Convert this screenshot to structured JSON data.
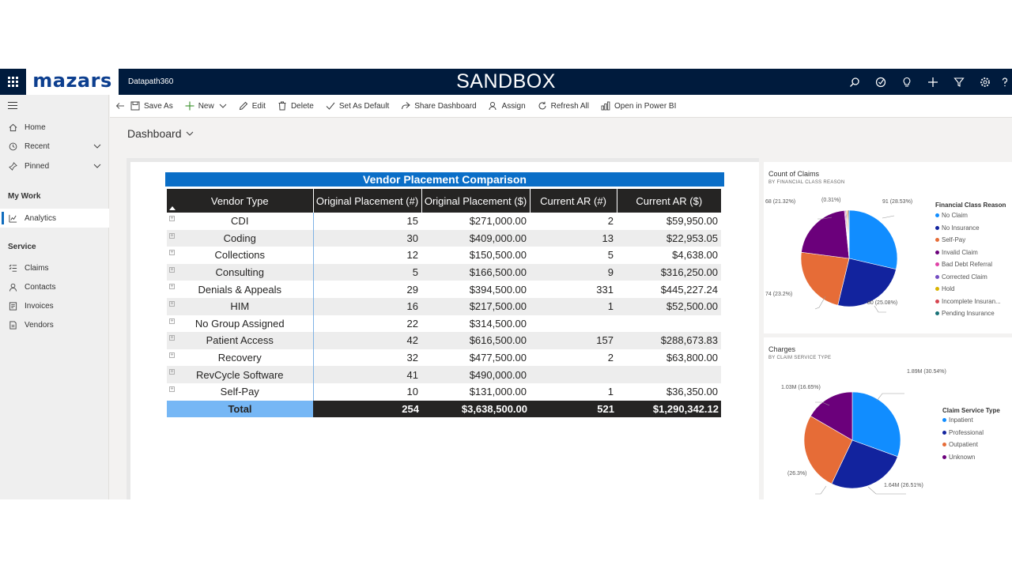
{
  "topbar": {
    "logo": "mazars",
    "app_name": "Datapath360",
    "environment": "SANDBOX",
    "icons": [
      "search-icon",
      "target-icon",
      "lightbulb-icon",
      "plus-icon",
      "filter-icon",
      "gear-icon",
      "help-icon"
    ]
  },
  "sidebar": {
    "items": [
      {
        "label": "Home",
        "icon": "home-icon"
      },
      {
        "label": "Recent",
        "icon": "clock-icon"
      },
      {
        "label": "Pinned",
        "icon": "pin-icon"
      }
    ],
    "my_work_label": "My Work",
    "analytics_label": "Analytics",
    "service_label": "Service",
    "service_items": [
      {
        "label": "Claims"
      },
      {
        "label": "Contacts"
      },
      {
        "label": "Invoices"
      },
      {
        "label": "Vendors"
      }
    ]
  },
  "commandbar": {
    "save_as": "Save As",
    "new": "New",
    "edit": "Edit",
    "delete": "Delete",
    "set_default": "Set As Default",
    "share": "Share Dashboard",
    "assign": "Assign",
    "refresh": "Refresh All",
    "open_powerbi": "Open in Power BI"
  },
  "dashboard": {
    "title": "Dashboard"
  },
  "table": {
    "title": "Vendor Placement Comparison",
    "headers": [
      "Vendor Type",
      "Original Placement (#)",
      "Original Placement ($)",
      "Current AR (#)",
      "Current AR ($)"
    ],
    "rows": [
      [
        "CDI",
        "15",
        "$271,000.00",
        "2",
        "$59,950.00"
      ],
      [
        "Coding",
        "30",
        "$409,000.00",
        "13",
        "$22,953.05"
      ],
      [
        "Collections",
        "12",
        "$150,500.00",
        "5",
        "$4,638.00"
      ],
      [
        "Consulting",
        "5",
        "$166,500.00",
        "9",
        "$316,250.00"
      ],
      [
        "Denials & Appeals",
        "29",
        "$394,500.00",
        "331",
        "$445,227.24"
      ],
      [
        "HIM",
        "16",
        "$217,500.00",
        "1",
        "$52,500.00"
      ],
      [
        "No Group Assigned",
        "22",
        "$314,500.00",
        "",
        ""
      ],
      [
        "Patient Access",
        "42",
        "$616,500.00",
        "157",
        "$288,673.83"
      ],
      [
        "Recovery",
        "32",
        "$477,500.00",
        "2",
        "$63,800.00"
      ],
      [
        "RevCycle Software",
        "41",
        "$490,000.00",
        "",
        ""
      ],
      [
        "Self-Pay",
        "10",
        "$131,000.00",
        "1",
        "$36,350.00"
      ]
    ],
    "total": [
      "Total",
      "254",
      "$3,638,500.00",
      "521",
      "$1,290,342.12"
    ]
  },
  "chart_data": [
    {
      "type": "pie",
      "title": "Count of Claims",
      "subtitle": "BY FINANCIAL CLASS REASON",
      "legend_title": "Financial Class Reason",
      "legend_position": "right",
      "categories": [
        "No Claim",
        "No Insurance",
        "Self-Pay",
        "Invalid Claim",
        "Bad Debt Referral",
        "Corrected Claim",
        "Hold",
        "Incomplete Insuran...",
        "Pending Insurance"
      ],
      "values": [
        91,
        80,
        74,
        68,
        1,
        1,
        1,
        1,
        1
      ],
      "colors": [
        "#118dff",
        "#12239e",
        "#e66c37",
        "#6b007b",
        "#e044a7",
        "#744ec2",
        "#d9b300",
        "#d64550",
        "#197278"
      ],
      "labels": [
        "91 (28.53%)",
        "80 (25.08%)",
        "74 (23.2%)",
        "68 (21.32%)",
        "(0.31%)"
      ]
    },
    {
      "type": "pie",
      "title": "Charges",
      "subtitle": "BY CLAIM SERVICE TYPE",
      "legend_title": "Claim Service Type",
      "legend_position": "right",
      "categories": [
        "Inpatient",
        "Professional",
        "Outpatient",
        "Unknown"
      ],
      "values": [
        30.54,
        26.51,
        26.3,
        16.65
      ],
      "colors": [
        "#118dff",
        "#12239e",
        "#e66c37",
        "#6b007b"
      ],
      "labels": [
        "1.89M (30.54%)",
        "1.64M (26.51%)",
        "(26.3%)",
        "1.03M (16.65%)"
      ]
    }
  ]
}
